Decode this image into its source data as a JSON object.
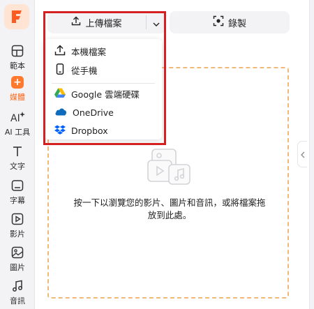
{
  "sidebar": {
    "items": [
      {
        "label": "範本",
        "icon": "layout-icon"
      },
      {
        "label": "媒體",
        "icon": "media-plus-icon"
      },
      {
        "label": "AI 工具",
        "icon": "ai-sparkle-icon"
      },
      {
        "label": "文字",
        "icon": "text-icon"
      },
      {
        "label": "字幕",
        "icon": "subtitle-icon"
      },
      {
        "label": "影片",
        "icon": "video-play-icon"
      },
      {
        "label": "圖片",
        "icon": "image-icon"
      },
      {
        "label": "音訊",
        "icon": "music-note-icon"
      }
    ]
  },
  "toolbar": {
    "upload_label": "上傳檔案",
    "record_label": "錄製"
  },
  "menu": {
    "items": [
      {
        "label": "本機檔案",
        "icon": "upload-icon"
      },
      {
        "label": "從手機",
        "icon": "phone-icon"
      },
      {
        "label": "Google 雲端硬碟",
        "icon": "google-drive-icon"
      },
      {
        "label": "OneDrive",
        "icon": "onedrive-icon"
      },
      {
        "label": "Dropbox",
        "icon": "dropbox-icon"
      }
    ]
  },
  "dropzone": {
    "line1": "按一下以瀏覽您的影片、圖片和音訊，或將檔案拖",
    "line2": "放到此處。"
  },
  "colors": {
    "accent": "#ff6a1f",
    "highlight": "#d42020",
    "dashed_border": "#f0b97a"
  }
}
